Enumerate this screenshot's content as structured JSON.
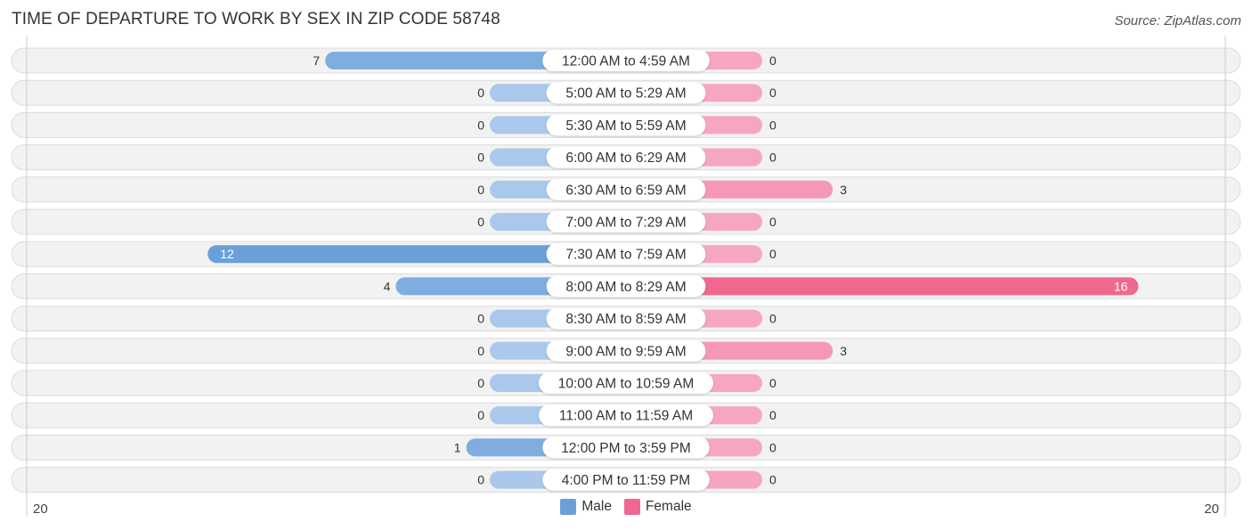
{
  "header": {
    "title": "TIME OF DEPARTURE TO WORK BY SEX IN ZIP CODE 58748",
    "source": "Source: ZipAtlas.com"
  },
  "colors": {
    "male_strong": "#6aa0d8",
    "male_light": "#a9c8eb",
    "female_strong": "#f06890",
    "female_light": "#f7a6c0",
    "row_bg": "#f2f2f2",
    "row_border": "#dcdcdc"
  },
  "legend": {
    "male_label": "Male",
    "female_label": "Female"
  },
  "axis": {
    "left_label": "20",
    "right_label": "20"
  },
  "chart_data": {
    "type": "bar",
    "orientation": "horizontal-diverging",
    "title": "TIME OF DEPARTURE TO WORK BY SEX IN ZIP CODE 58748",
    "xlabel": "",
    "ylabel": "",
    "xlim": [
      -20,
      20
    ],
    "legend_position": "bottom-center",
    "grid": false,
    "categories": [
      "12:00 AM to 4:59 AM",
      "5:00 AM to 5:29 AM",
      "5:30 AM to 5:59 AM",
      "6:00 AM to 6:29 AM",
      "6:30 AM to 6:59 AM",
      "7:00 AM to 7:29 AM",
      "7:30 AM to 7:59 AM",
      "8:00 AM to 8:29 AM",
      "8:30 AM to 8:59 AM",
      "9:00 AM to 9:59 AM",
      "10:00 AM to 10:59 AM",
      "11:00 AM to 11:59 AM",
      "12:00 PM to 3:59 PM",
      "4:00 PM to 11:59 PM"
    ],
    "series": [
      {
        "name": "Male",
        "values": [
          7,
          0,
          0,
          0,
          0,
          0,
          12,
          4,
          0,
          0,
          0,
          0,
          1,
          0
        ]
      },
      {
        "name": "Female",
        "values": [
          0,
          0,
          0,
          0,
          3,
          0,
          0,
          16,
          0,
          3,
          0,
          0,
          0,
          0
        ]
      }
    ]
  }
}
